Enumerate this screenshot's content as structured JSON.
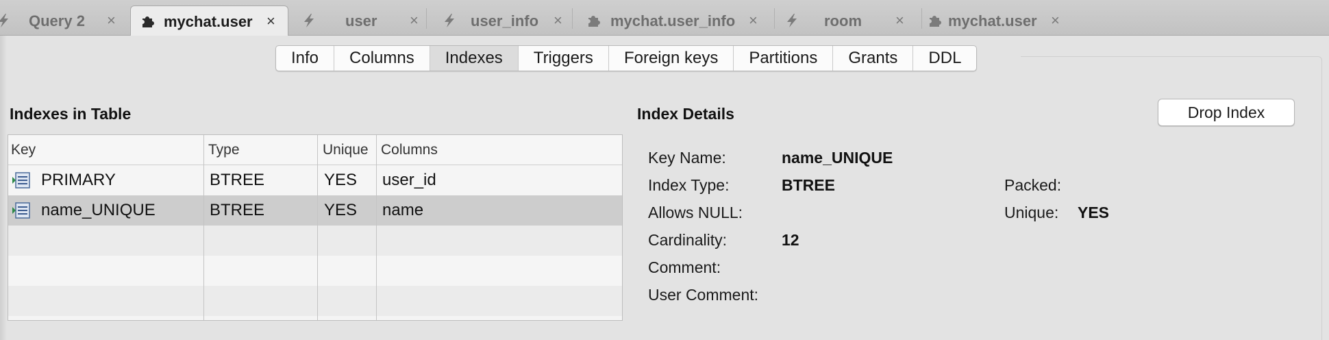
{
  "tabs": [
    {
      "label": "Query 2",
      "icon": "bolt-icon",
      "active": false
    },
    {
      "label": "mychat.user",
      "icon": "puzzle-icon",
      "active": true
    },
    {
      "label": "user",
      "icon": "bolt-icon",
      "active": false
    },
    {
      "label": "user_info",
      "icon": "bolt-icon",
      "active": false
    },
    {
      "label": "mychat.user_info",
      "icon": "puzzle-icon",
      "active": false
    },
    {
      "label": "room",
      "icon": "bolt-icon",
      "active": false
    },
    {
      "label": "mychat.user",
      "icon": "puzzle-icon",
      "active": false
    }
  ],
  "close_glyph": "×",
  "segments": [
    "Info",
    "Columns",
    "Indexes",
    "Triggers",
    "Foreign keys",
    "Partitions",
    "Grants",
    "DDL"
  ],
  "selected_segment": "Indexes",
  "indexes": {
    "title": "Indexes in Table",
    "columns": [
      "Key",
      "Type",
      "Unique",
      "Columns"
    ],
    "rows": [
      {
        "key": "PRIMARY",
        "type": "BTREE",
        "unique": "YES",
        "columns": "user_id"
      },
      {
        "key": "name_UNIQUE",
        "type": "BTREE",
        "unique": "YES",
        "columns": "name"
      }
    ],
    "selected_row": "name_UNIQUE"
  },
  "details": {
    "title": "Index Details",
    "drop_button": "Drop Index",
    "key_name_label": "Key Name:",
    "key_name": "name_UNIQUE",
    "index_type_label": "Index Type:",
    "index_type": "BTREE",
    "allows_null_label": "Allows NULL:",
    "cardinality_label": "Cardinality:",
    "cardinality": "12",
    "comment_label": "Comment:",
    "user_comment_label": "User Comment:",
    "packed_label": "Packed:",
    "unique_label": "Unique:",
    "unique": "YES"
  },
  "colors": {
    "tabbar": "#c8c8c8",
    "active_tab": "#ececec",
    "selected_row": "#cdcdcd",
    "selected_segment": "#dcdcdc"
  }
}
